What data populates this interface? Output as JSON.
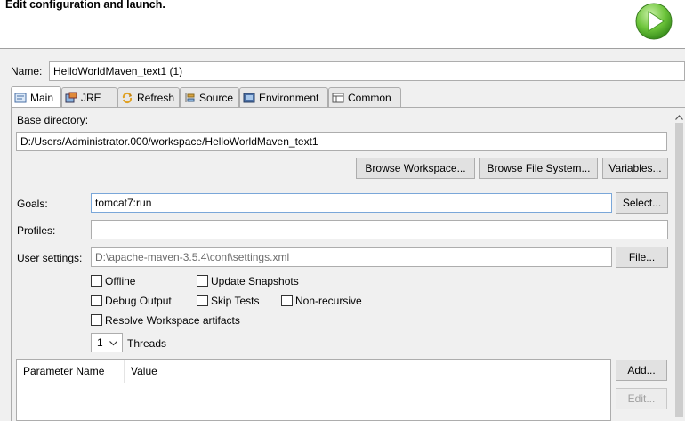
{
  "header": {
    "title": "Edit configuration and launch.",
    "run_icon": "run-play-icon"
  },
  "name_row": {
    "label": "Name:",
    "value": "HelloWorldMaven_text1 (1)"
  },
  "tabs": [
    {
      "label": "Main",
      "icon": "main-tab-icon",
      "active": true
    },
    {
      "label": "JRE",
      "icon": "jre-icon"
    },
    {
      "label": "Refresh",
      "icon": "refresh-icon"
    },
    {
      "label": "Source",
      "icon": "source-icon"
    },
    {
      "label": "Environment",
      "icon": "environment-icon"
    },
    {
      "label": "Common",
      "icon": "common-icon"
    }
  ],
  "main": {
    "base_directory_label": "Base directory:",
    "base_directory_value": "D:/Users/Administrator.000/workspace/HelloWorldMaven_text1",
    "browse_workspace": "Browse Workspace...",
    "browse_file_system": "Browse File System...",
    "variables": "Variables...",
    "goals_label": "Goals:",
    "goals_value": "tomcat7:run",
    "select_button": "Select...",
    "profiles_label": "Profiles:",
    "profiles_value": "",
    "user_settings_label": "User settings:",
    "user_settings_value": "D:\\apache-maven-3.5.4\\conf\\settings.xml",
    "file_button": "File...",
    "checkboxes": {
      "offline": "Offline",
      "update_snapshots": "Update Snapshots",
      "debug_output": "Debug Output",
      "skip_tests": "Skip Tests",
      "non_recursive": "Non-recursive",
      "resolve_workspace": "Resolve Workspace artifacts"
    },
    "threads_value": "1",
    "threads_label": "Threads",
    "table": {
      "columns": [
        "Parameter Name",
        "Value"
      ]
    },
    "add_button": "Add...",
    "edit_button": "Edit..."
  }
}
